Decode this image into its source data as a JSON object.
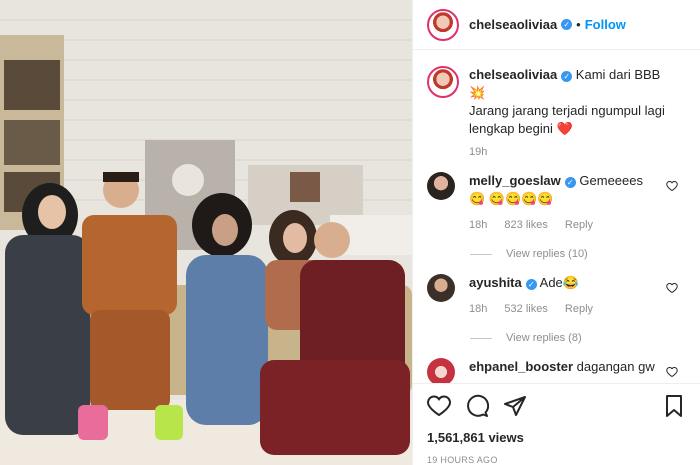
{
  "header": {
    "username": "chelseaoliviaa",
    "separator": "•",
    "follow_label": "Follow"
  },
  "caption": {
    "username": "chelseaoliviaa",
    "text_line1": "Kami dari BBB ",
    "emoji_spark": "💥",
    "text_line2": "Jarang jarang terjadi ngumpul lagi lengkap begini ",
    "emoji_heart": "❤️",
    "time": "19h"
  },
  "comments": [
    {
      "username": "melly_goeslaw",
      "verified": true,
      "text": "Gemeeees 😋 😋😋😋😋",
      "time": "18h",
      "likes": "823 likes",
      "reply": "Reply",
      "view_replies": "View replies (10)"
    },
    {
      "username": "ayushita",
      "verified": true,
      "text": "Ade😂",
      "time": "18h",
      "likes": "532 likes",
      "reply": "Reply",
      "view_replies": "View replies (8)"
    },
    {
      "username": "ehpanel_booster",
      "verified": false,
      "text": "dagangan gw"
    }
  ],
  "footer": {
    "views": "1,561,861 views",
    "posted_ago": "19 HOURS AGO"
  },
  "colors": {
    "accent": "#0095f6",
    "verified": "#3897f0",
    "muted": "#8e8e8e",
    "heart": "#ed4956"
  }
}
